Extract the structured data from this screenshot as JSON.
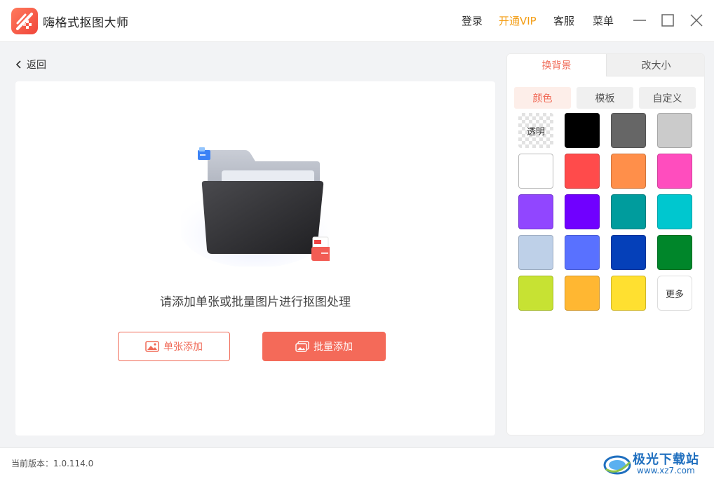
{
  "app": {
    "title": "嗨格式抠图大师"
  },
  "topnav": {
    "login": "登录",
    "vip": "开通VIP",
    "service": "客服",
    "menu": "菜单"
  },
  "nav": {
    "back_label": "返回"
  },
  "main": {
    "hint": "请添加单张或批量图片进行抠图处理",
    "single_add_label": "单张添加",
    "batch_add_label": "批量添加"
  },
  "side": {
    "tabs": [
      {
        "label": "换背景",
        "active": true
      },
      {
        "label": "改大小",
        "active": false
      }
    ],
    "subtabs": [
      {
        "label": "颜色",
        "active": true
      },
      {
        "label": "模板",
        "active": false
      },
      {
        "label": "自定义",
        "active": false
      }
    ],
    "transparent_label": "透明",
    "more_label": "更多",
    "colors": [
      "transparent",
      "#000000",
      "#666666",
      "#cbcbcb",
      "#ffffff",
      "#ff4b4b",
      "#ff8f4a",
      "#ff4dbe",
      "#9146ff",
      "#7000ff",
      "#009c9d",
      "#00c7cf",
      "#bed0e8",
      "#5971ff",
      "#0540b9",
      "#00862a",
      "#c7e233",
      "#ffb732",
      "#ffe030",
      "more"
    ]
  },
  "footer": {
    "version": "当前版本：1.0.114.0",
    "watermark_title": "极光下载站",
    "watermark_url": "www.xz7.com"
  },
  "theme": {
    "accent": "#f06a57",
    "vip": "#f39c12"
  }
}
